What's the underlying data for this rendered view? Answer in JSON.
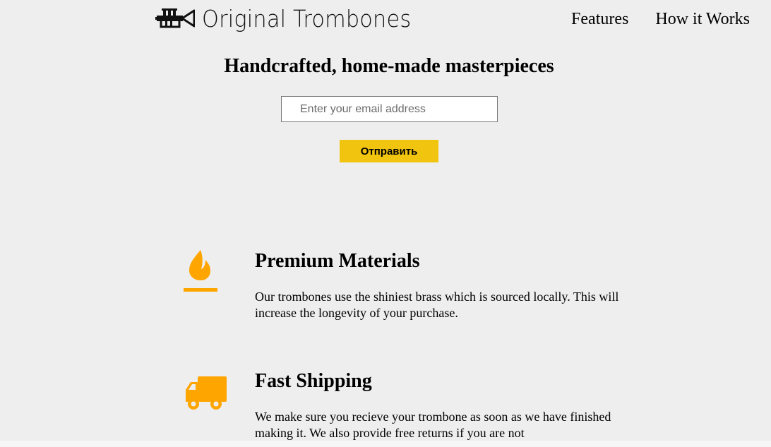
{
  "header": {
    "brand_name": "Original Trombones",
    "logo_icon": "trumpet-icon",
    "nav": [
      {
        "label": "Features"
      },
      {
        "label": "How it Works"
      }
    ]
  },
  "hero": {
    "title": "Handcrafted, home-made masterpieces",
    "email_placeholder": "Enter your email address",
    "submit_label": "Отправить"
  },
  "features": [
    {
      "icon": "fire-icon",
      "title": "Premium Materials",
      "description": "Our trombones use the shiniest brass which is sourced locally. This will increase the longevity of your purchase."
    },
    {
      "icon": "truck-icon",
      "title": "Fast Shipping",
      "description": "We make sure you recieve your trombone as soon as we have finished making it. We also provide free returns if you are not"
    }
  ],
  "colors": {
    "background": "#eeeeee",
    "accent": "#f1c40f",
    "icon": "#ffa500"
  }
}
